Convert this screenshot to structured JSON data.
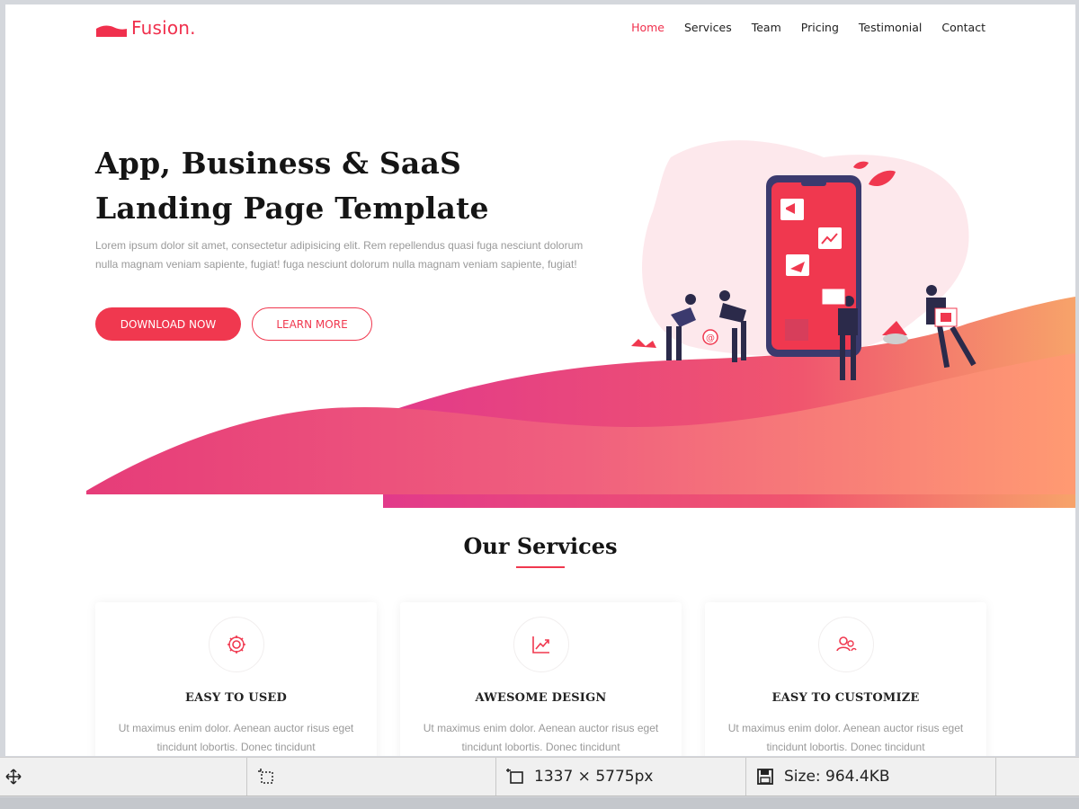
{
  "brand": {
    "name": "Fusion.",
    "accent": "#f0304d",
    "gradient_start": "#e8336a",
    "gradient_end": "#ff9a6e"
  },
  "nav": {
    "items": [
      {
        "label": "Home",
        "active": true
      },
      {
        "label": "Services",
        "active": false
      },
      {
        "label": "Team",
        "active": false
      },
      {
        "label": "Pricing",
        "active": false
      },
      {
        "label": "Testimonial",
        "active": false
      },
      {
        "label": "Contact",
        "active": false
      }
    ]
  },
  "hero": {
    "title_line1": "App, Business & SaaS",
    "title_line2": "Landing Page Template",
    "description": "Lorem ipsum dolor sit amet, consectetur adipisicing elit. Rem repellendus quasi fuga nesciunt dolorum nulla magnam veniam sapiente, fugiat! fuga nesciunt dolorum nulla magnam veniam sapiente, fugiat!",
    "primary_button": "DOWNLOAD NOW",
    "secondary_button": "LEARN MORE",
    "illustration_icons": [
      "megaphone-icon",
      "chart-icon",
      "paper-plane-icon",
      "at-sign-icon",
      "leaf-icon"
    ]
  },
  "services": {
    "title": "Our Services",
    "cards": [
      {
        "icon": "gear-icon",
        "title": "EASY TO USED",
        "text": "Ut maximus enim dolor. Aenean auctor risus eget tincidunt lobortis. Donec tincidunt"
      },
      {
        "icon": "chart-line-icon",
        "title": "AWESOME DESIGN",
        "text": "Ut maximus enim dolor. Aenean auctor risus eget tincidunt lobortis. Donec tincidunt"
      },
      {
        "icon": "users-icon",
        "title": "EASY TO CUSTOMIZE",
        "text": "Ut maximus enim dolor. Aenean auctor risus eget tincidunt lobortis. Donec tincidunt"
      }
    ]
  },
  "statusbar": {
    "move_icon": "move-icon",
    "crop_icon": "selection-icon",
    "dimensions_icon": "resize-icon",
    "dimensions": "1337 × 5775px",
    "save_icon": "save-icon",
    "size": "Size: 964.4KB"
  }
}
